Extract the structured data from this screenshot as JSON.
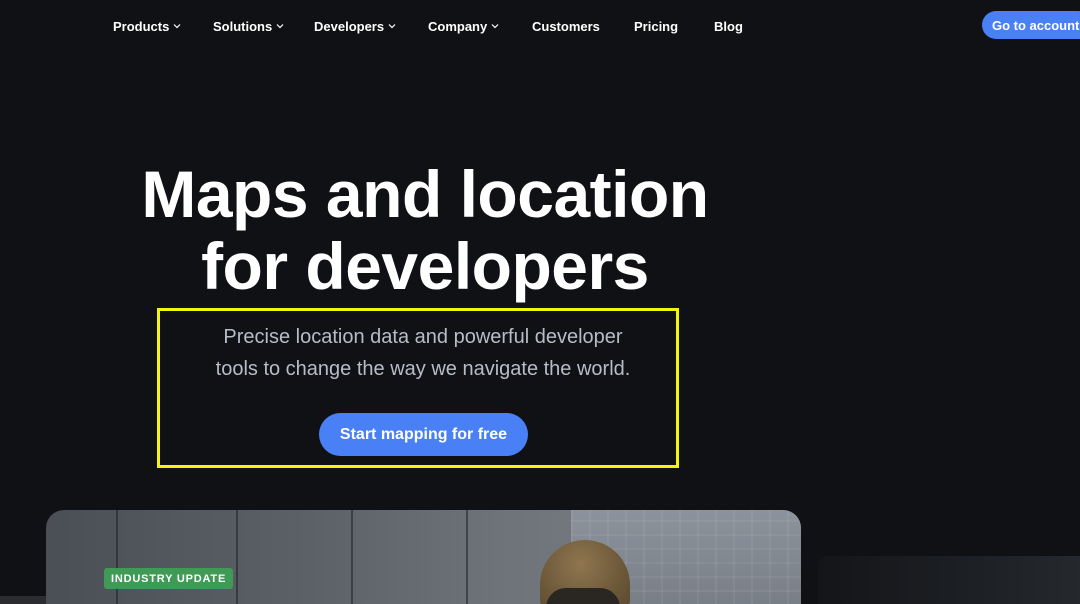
{
  "nav": {
    "items": [
      {
        "label": "Products",
        "dropdown": true
      },
      {
        "label": "Solutions",
        "dropdown": true
      },
      {
        "label": "Developers",
        "dropdown": true
      },
      {
        "label": "Company",
        "dropdown": true
      },
      {
        "label": "Customers",
        "dropdown": false
      },
      {
        "label": "Pricing",
        "dropdown": false
      },
      {
        "label": "Blog",
        "dropdown": false
      }
    ],
    "cta_label": "Go to account"
  },
  "hero": {
    "title_line1": "Maps and location",
    "title_line2": "for developers",
    "subtitle_line1": "Precise location data and powerful developer",
    "subtitle_line2": "tools to change the way we navigate the world.",
    "cta_label": "Start mapping for free"
  },
  "feature": {
    "badge": "INDUSTRY UPDATE"
  },
  "colors": {
    "background": "#101114",
    "accent": "#4a80f5",
    "highlight": "#f5f50f",
    "badge": "#3f9a55",
    "subtitle_text": "#b7bcc6"
  }
}
